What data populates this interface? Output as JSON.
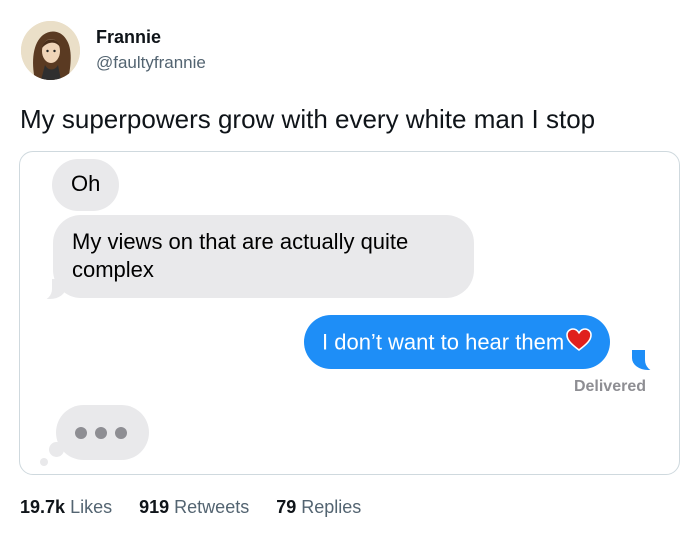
{
  "profile": {
    "name": "Frannie",
    "handle": "@faultyfrannie"
  },
  "tweet": {
    "text": "My superpowers grow with every white man I stop"
  },
  "messages": {
    "m1": "Oh",
    "m2": "My views on that are actually quite complex",
    "m3": "I don’t want to hear them",
    "status": "Delivered"
  },
  "stats": {
    "likes": {
      "count": "19.7k",
      "label": "Likes"
    },
    "retweets": {
      "count": "919",
      "label": "Retweets"
    },
    "replies": {
      "count": "79",
      "label": "Replies"
    }
  },
  "colors": {
    "sent": "#1e8ef7",
    "received": "#e9e9eb",
    "muted": "#536471"
  },
  "icons": {
    "heart": "red-heart-emoji",
    "typing": "typing-indicator"
  }
}
